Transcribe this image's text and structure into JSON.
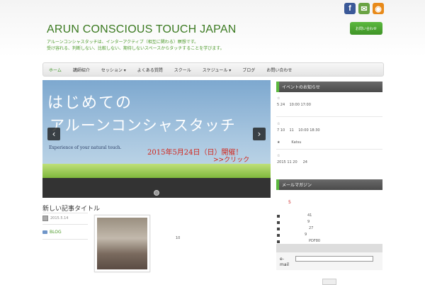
{
  "header": {
    "site_title": "ARUN CONSCIOUS TOUCH JAPAN",
    "tagline_1": "アルーンコンシャスタッチは、インターアクティブ（相互に関わる）瞑想です。",
    "tagline_2": "受け容れる、判断しない、比較しない、期待しないスペースからタッチすることを学びます。",
    "contact_label": "お問い合わせ",
    "social": [
      {
        "name": "facebook",
        "glyph": "f",
        "color": "#3b5998"
      },
      {
        "name": "mail",
        "glyph": "✉",
        "color": "#6aa344"
      },
      {
        "name": "rss",
        "glyph": "◉",
        "color": "#e88a1a"
      }
    ]
  },
  "nav": {
    "items": [
      {
        "label": "ホーム",
        "active": true
      },
      {
        "label": "講師紹介"
      },
      {
        "label": "セッション ▾"
      },
      {
        "label": "よくある質問"
      },
      {
        "label": "スクール"
      },
      {
        "label": "スケジュール ▾"
      },
      {
        "label": "ブログ"
      },
      {
        "label": "お問い合わせ"
      }
    ]
  },
  "slider": {
    "line1": "はじめての",
    "line2": "アルーンコンシャスタッチ",
    "subtitle": "Experience of your natural touch.",
    "date": "2015年5月24日（日）開催！",
    "click": ">>クリック",
    "prev": "‹",
    "next": "›"
  },
  "post": {
    "title": "新しい記事タイトル",
    "date": "2015.5.14",
    "category": "BLOG",
    "excerpt": "10"
  },
  "sidebar": {
    "widget1_title": "イベントのお知らせ",
    "items": [
      {
        "bullet": "☆",
        "text": "5 24    10:00 17:00"
      },
      {
        "bullet": "☆",
        "text": "7 10    11    10:00 18:30"
      },
      {
        "bullet": "★",
        "text": "          Katsu"
      },
      {
        "bullet": "☆",
        "text": "2015 11 20     24"
      }
    ],
    "widget2_title": "メールマガジン",
    "red_number": "5",
    "list": [
      "41",
      "9",
      "27",
      "9",
      "PDF80"
    ],
    "email_label": "e-mail"
  },
  "colors": {
    "brand_green": "#3b7a21",
    "accent_green": "#5bb83e",
    "widget_dark": "#555555",
    "red": "#d2251b"
  }
}
